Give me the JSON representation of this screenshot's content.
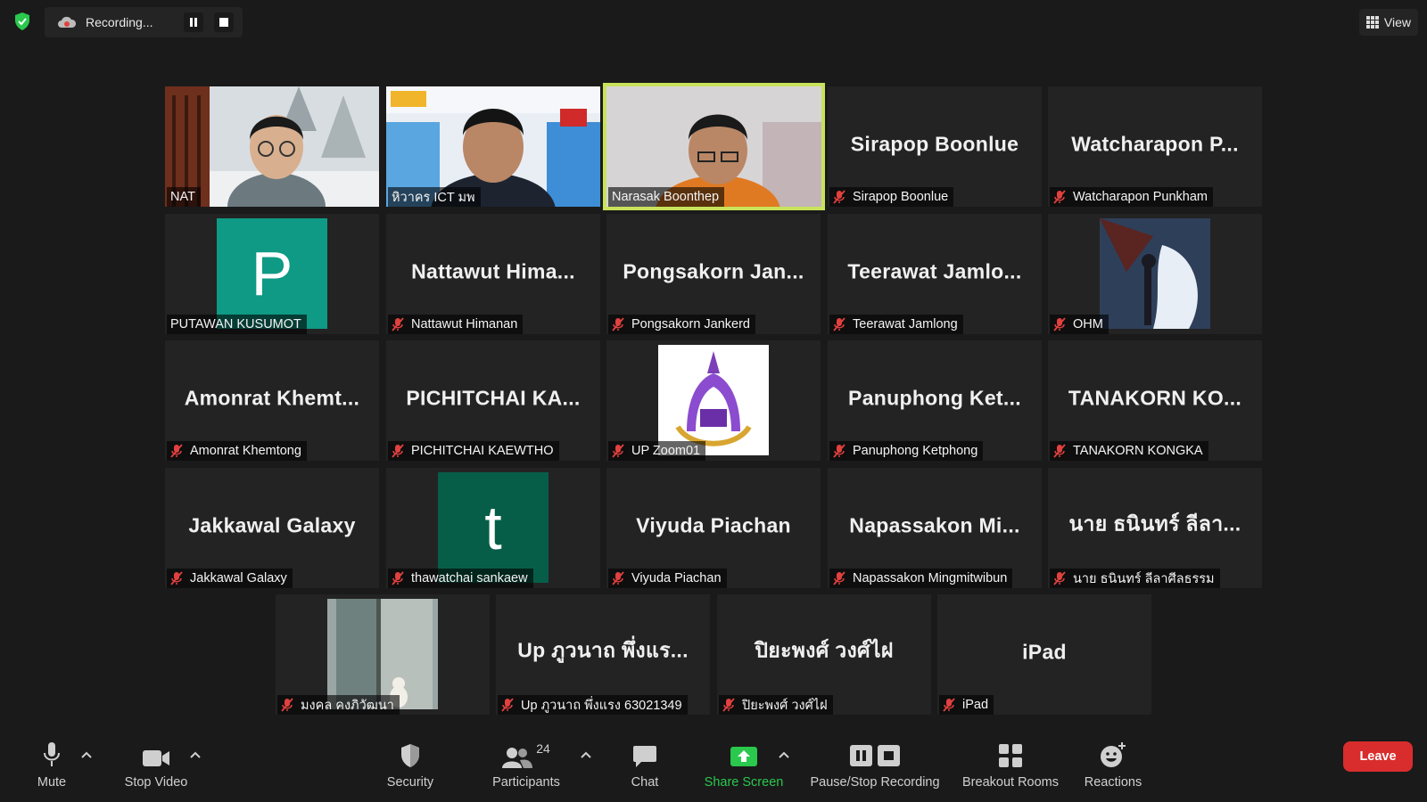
{
  "topbar": {
    "recording_label": "Recording...",
    "view_label": "View"
  },
  "tiles": [
    {
      "display": "",
      "label": "NAT"
    },
    {
      "display": "",
      "label": "หิวาคร ICT มพ"
    },
    {
      "display": "",
      "label": "Narasak Boonthep"
    },
    {
      "display": "Sirapop Boonlue",
      "label": "Sirapop Boonlue"
    },
    {
      "display": "Watcharapon  P...",
      "label": "Watcharapon Punkham"
    },
    {
      "display": "P",
      "label": "PUTAWAN KUSUMOT"
    },
    {
      "display": "Nattawut  Hima...",
      "label": "Nattawut Himanan"
    },
    {
      "display": "Pongsakorn  Jan...",
      "label": "Pongsakorn Jankerd"
    },
    {
      "display": "Teerawat  Jamlo...",
      "label": "Teerawat Jamlong"
    },
    {
      "display": "",
      "label": "OHM"
    },
    {
      "display": "Amonrat  Khemt...",
      "label": "Amonrat Khemtong"
    },
    {
      "display": "PICHITCHAI  KA...",
      "label": "PICHITCHAI KAEWTHO"
    },
    {
      "display": "",
      "label": "UP Zoom01"
    },
    {
      "display": "Panuphong  Ket...",
      "label": "Panuphong Ketphong"
    },
    {
      "display": "TANAKORN  KO...",
      "label": "TANAKORN KONGKA"
    },
    {
      "display": "Jakkawal Galaxy",
      "label": "Jakkawal Galaxy"
    },
    {
      "display": "t",
      "label": "thawatchai sankaew"
    },
    {
      "display": "Viyuda Piachan",
      "label": "Viyuda Piachan"
    },
    {
      "display": "Napassakon  Mi...",
      "label": "Napassakon Mingmitwibun"
    },
    {
      "display": "นาย ธนินทร์ ลีลา...",
      "label": "นาย ธนินทร์ ลีลาศีลธรรม"
    },
    {
      "display": "",
      "label": "มงคล คงภิวัฒนา"
    },
    {
      "display": "Up ภูวนาถ พึ่งแร...",
      "label": "Up ภูวนาถ พึ่งแรง 63021349"
    },
    {
      "display": "ปิยะพงศ์ วงศ์ไฝ",
      "label": "ปิยะพงศ์ วงศ์ไฝ"
    },
    {
      "display": "iPad",
      "label": "iPad"
    }
  ],
  "toolbar": {
    "mute": "Mute",
    "stop_video": "Stop Video",
    "security": "Security",
    "participants": "Participants",
    "participant_count": "24",
    "chat": "Chat",
    "share_screen": "Share Screen",
    "pause_stop_recording": "Pause/Stop Recording",
    "breakout_rooms": "Breakout Rooms",
    "reactions": "Reactions",
    "leave": "Leave"
  },
  "colors": {
    "active_speaker_border": "#c8e35b",
    "avatar_p": "#0e9a85",
    "avatar_t": "#075e48",
    "leave_button": "#d92d2d",
    "share_screen": "#2ac84d",
    "muted_mic": "#e0413f"
  }
}
